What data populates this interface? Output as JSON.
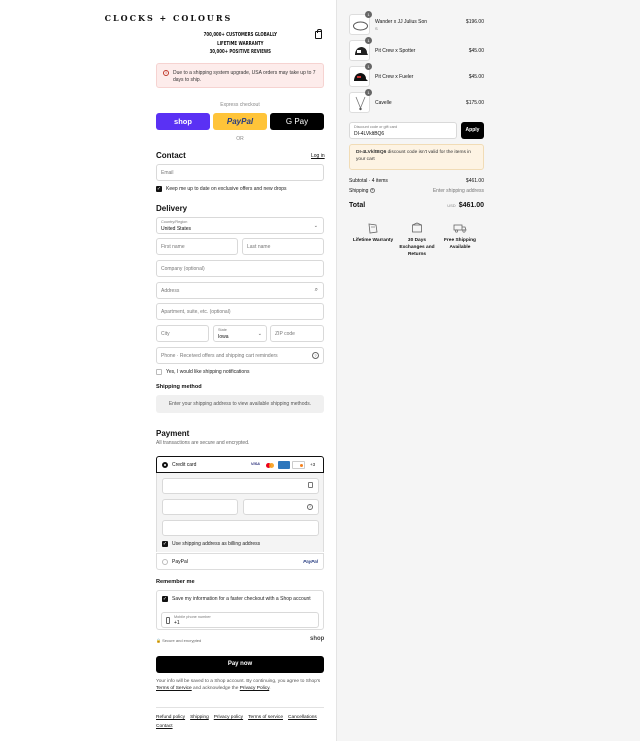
{
  "brand": {
    "logo": "CLOCKS + COLOURS",
    "banner": [
      "700,000+ CUSTOMERS GLOBALLY",
      "LIFETIME WARRANTY",
      "30,000+ POSITIVE REVIEWS"
    ]
  },
  "notice": {
    "text": "Due to a shipping system upgrade, USA orders may take up to 7 days to ship."
  },
  "express": {
    "title": "Express checkout",
    "shop": "shop",
    "paypal": "PayPal",
    "gpay": "G Pay",
    "or": "OR"
  },
  "contact": {
    "title": "Contact",
    "login": "Log in",
    "email_placeholder": "Email",
    "newsletter": "Keep me up to date on exclusive offers and new drops"
  },
  "delivery": {
    "title": "Delivery",
    "country_label": "Country/Region",
    "country": "United States",
    "first_name": "First name",
    "last_name": "Last name",
    "company": "Company (optional)",
    "address": "Address",
    "apartment": "Apartment, suite, etc. (optional)",
    "city": "City",
    "state_label": "State",
    "state": "Iowa",
    "zip": "ZIP code",
    "phone": "Phone · Received offers and shipping cart reminders",
    "sms": "Yes, I would like shipping notifications"
  },
  "shipping_method": {
    "title": "Shipping method",
    "message": "Enter your shipping address to view available shipping methods."
  },
  "payment": {
    "title": "Payment",
    "subtitle": "All transactions are secure and encrypted.",
    "credit_card": "Credit card",
    "more_cards": "+3",
    "billing": "Use shipping address as billing address",
    "paypal": "PayPal",
    "paypal_logo": "PayPal",
    "card_brands": [
      "VISA",
      "MC",
      "AMEX",
      "DISCOVER"
    ]
  },
  "remember": {
    "title": "Remember me",
    "save": "Save my information for a faster checkout with a Shop account",
    "mobile_label": "Mobile phone number",
    "mobile_value": "+1",
    "secure": "Secure and encrypted",
    "shop_logo": "shop"
  },
  "pay_now": "Pay now",
  "legal": {
    "pre": "Your info will be saved to a Shop account. By continuing, you agree to Shop's ",
    "terms": "Terms of Service",
    "mid": " and acknowledge the ",
    "privacy": "Privacy Policy",
    "end": "."
  },
  "footer": [
    "Refund policy",
    "Shipping",
    "Privacy policy",
    "Terms of service",
    "Cancellations",
    "Contact"
  ],
  "cart": {
    "items": [
      {
        "qty": "1",
        "name": "Wander x JJ Julius Son",
        "variant": "S",
        "price": "$196.00"
      },
      {
        "qty": "1",
        "name": "Pit Crew x Spotter",
        "variant": "",
        "price": "$45.00"
      },
      {
        "qty": "1",
        "name": "Pit Crew x Fueler",
        "variant": "",
        "price": "$45.00"
      },
      {
        "qty": "1",
        "name": "Cavelle",
        "variant": "",
        "price": "$175.00"
      }
    ],
    "discount_label": "Discount code or gift card",
    "discount_value": "DI-4LVkltBQ6",
    "apply": "Apply",
    "warning_code": "DI-4LVkltBQ6",
    "warning_text": " discount code isn't valid for the items in your cart",
    "subtotal_label": "Subtotal · 4 items",
    "subtotal": "$461.00",
    "shipping_label": "Shipping",
    "shipping_value": "Enter shipping address",
    "total_label": "Total",
    "currency": "USD",
    "total": "$461.00"
  },
  "features": [
    {
      "icon": "warranty-icon",
      "label": "Lifetime Warranty"
    },
    {
      "icon": "box-icon",
      "label": "30 Days Exchanges and Returns"
    },
    {
      "icon": "truck-icon",
      "label": "Free Shipping Available"
    }
  ]
}
